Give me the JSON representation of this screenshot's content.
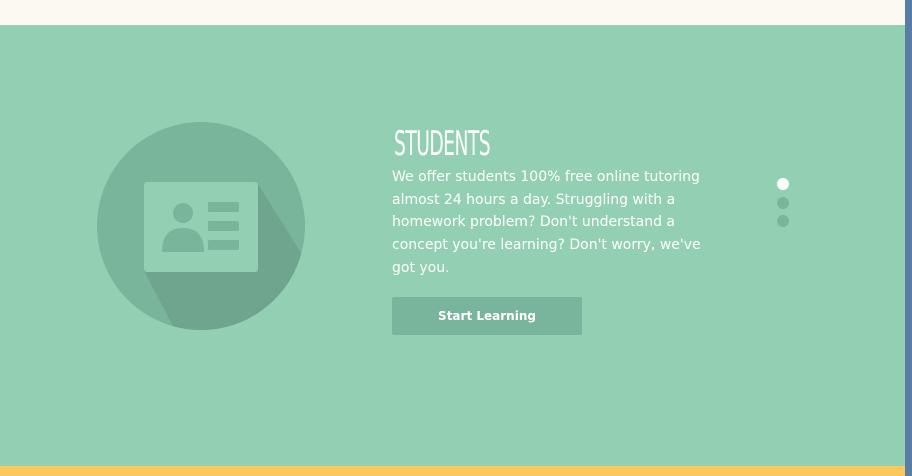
{
  "colors": {
    "hero_background": "#93d0b3",
    "top_band": "#fcf8f2",
    "bottom_band": "#fcc75b",
    "right_edge": "#5a7da6",
    "icon_circle": "#79b59b",
    "icon_shadow": "#6fa48e",
    "button_background": "#78b59c",
    "text": "#ffffff"
  },
  "slide": {
    "icon": "id-card-icon",
    "title": "Students",
    "description": "We offer students 100% free online tutoring almost 24 hours a day. Struggling with a homework problem? Don't understand a concept you're learning? Don't worry, we've got you.",
    "button_label": "Start Learning"
  },
  "pager": {
    "total": 3,
    "active_index": 0
  }
}
